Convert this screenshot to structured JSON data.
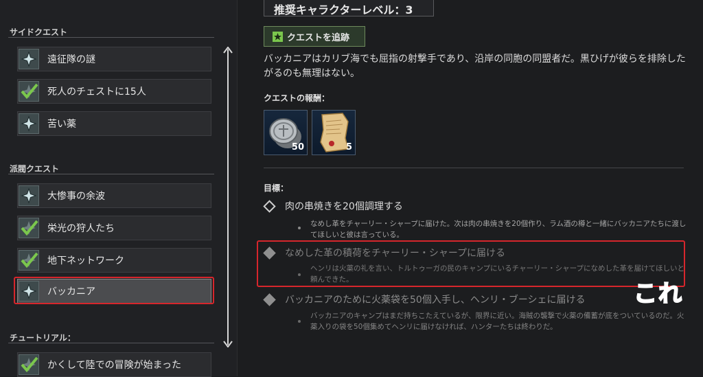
{
  "sidebar": {
    "sections": [
      {
        "title": "サイドクエスト"
      },
      {
        "title": "派閥クエスト"
      },
      {
        "title": "チュートリアル："
      }
    ],
    "items": [
      {
        "label": "遠征隊の謎",
        "icon": "compass-star-icon"
      },
      {
        "label": "死人のチェストに15人",
        "icon": "checkmark-icon"
      },
      {
        "label": "苦い薬",
        "icon": "compass-star-icon"
      },
      {
        "label": "大惨事の余波",
        "icon": "compass-star-icon"
      },
      {
        "label": "栄光の狩人たち",
        "icon": "checkmark-icon"
      },
      {
        "label": "地下ネットワーク",
        "icon": "checkmark-icon"
      },
      {
        "label": "バッカニア",
        "icon": "compass-star-icon",
        "selected": true
      },
      {
        "label": "かくして陸での冒険が始まった",
        "icon": "checkmark-icon"
      }
    ]
  },
  "detail": {
    "recommended_level": "推奨キャラクターレベル：3",
    "track_button": "クエストを追跡",
    "description": "バッカニアはカリブ海でも屈指の射撃手であり、沿岸の同胞の同盟者だ。黒ひげが彼らを排除したがるのも無理はない。",
    "rewards_title": "クエストの報酬：",
    "rewards": [
      {
        "icon": "silver-coin-icon",
        "count": "50"
      },
      {
        "icon": "treasure-map-icon",
        "count": "5"
      }
    ],
    "objectives_title": "目標：",
    "objectives": [
      {
        "title": "肉の串焼きを20個調理する",
        "description": "なめし革をチャーリー・シャープに届けた。次は肉の串焼きを20個作り、ラム酒の樽と一緒にバッカニアたちに渡してほしいと彼は言っている。"
      },
      {
        "title": "なめした革の積荷をチャーリー・シャープに届ける",
        "description": "ヘンリは火薬の礼を言い、トルトゥーガの民のキャンプにいるチャーリー・シャープになめした革を届けてほしいと頼んできた。"
      },
      {
        "title": "バッカニアのために火薬袋を50個入手し、ヘンリ・ブーシェに届ける",
        "description": "バッカニアのキャンプはまだ持ちこたえているが、限界に近い。海賊の襲撃で火薬の備蓄が底をついているのだ。火薬入りの袋を50個集めてヘンリに届けなければ、ハンターたちは終わりだ。"
      }
    ]
  },
  "annotation": {
    "text": "これ",
    "color": "#e8252b"
  },
  "colors": {
    "highlight": "#d7262c",
    "check": "#7bc74d"
  }
}
